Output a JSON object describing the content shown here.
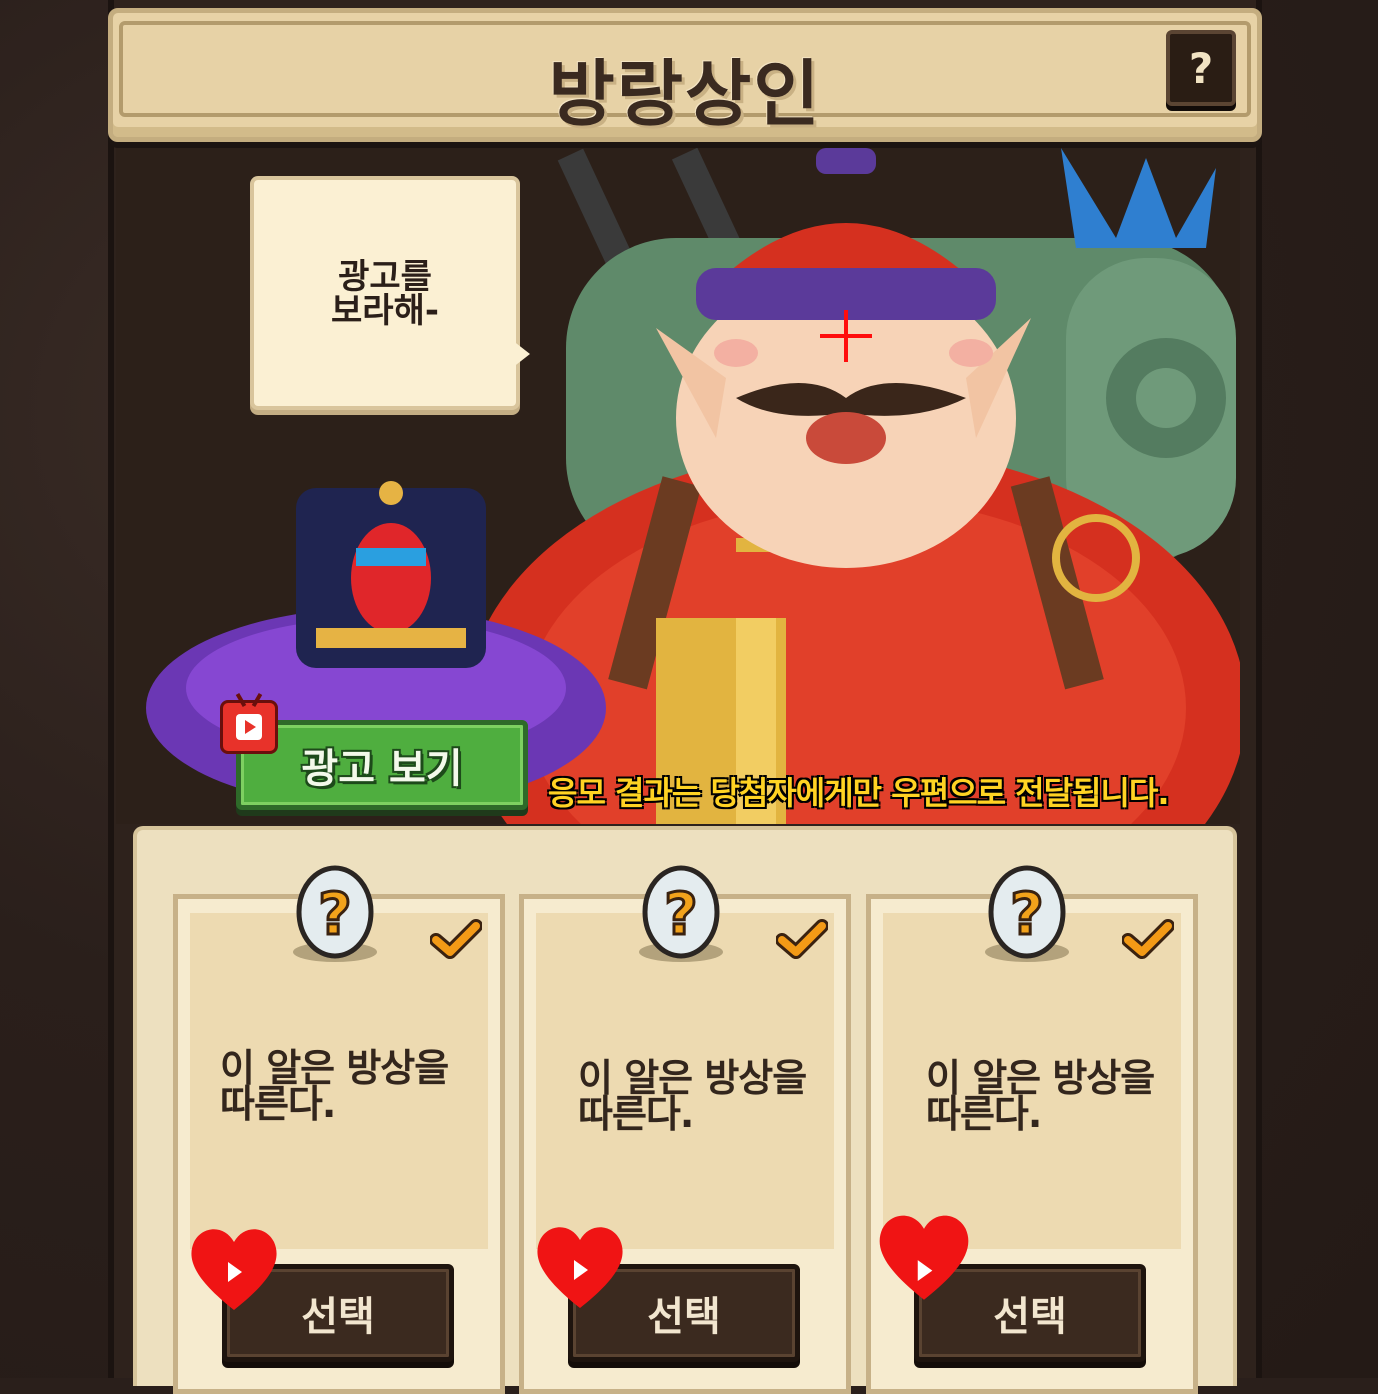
{
  "header": {
    "title": "방랑상인",
    "help_label": "?"
  },
  "scene": {
    "speech": "광고를\n보라해-",
    "ad_button_label": "광고 보기",
    "notice": "응모 결과는 당첨자에게만 우편으로 전달됩니다."
  },
  "cards": [
    {
      "text": "이 알은 방상을\n따른다.",
      "select_label": "선택"
    },
    {
      "text": "이 알은 방상을\n따른다.",
      "select_label": "선택"
    },
    {
      "text": "이 알은 방상을\n따른다.",
      "select_label": "선택"
    }
  ],
  "colors": {
    "header_bg": "#e7d2a6",
    "notice_text": "#ffd323",
    "ad_button": "#4fae3f",
    "heart": "#f01414",
    "check": "#f39a16"
  },
  "icons": [
    "help-icon",
    "tv-play-icon",
    "egg-question-icon",
    "checkmark-icon",
    "heart-play-icon",
    "crosshair-icon"
  ]
}
